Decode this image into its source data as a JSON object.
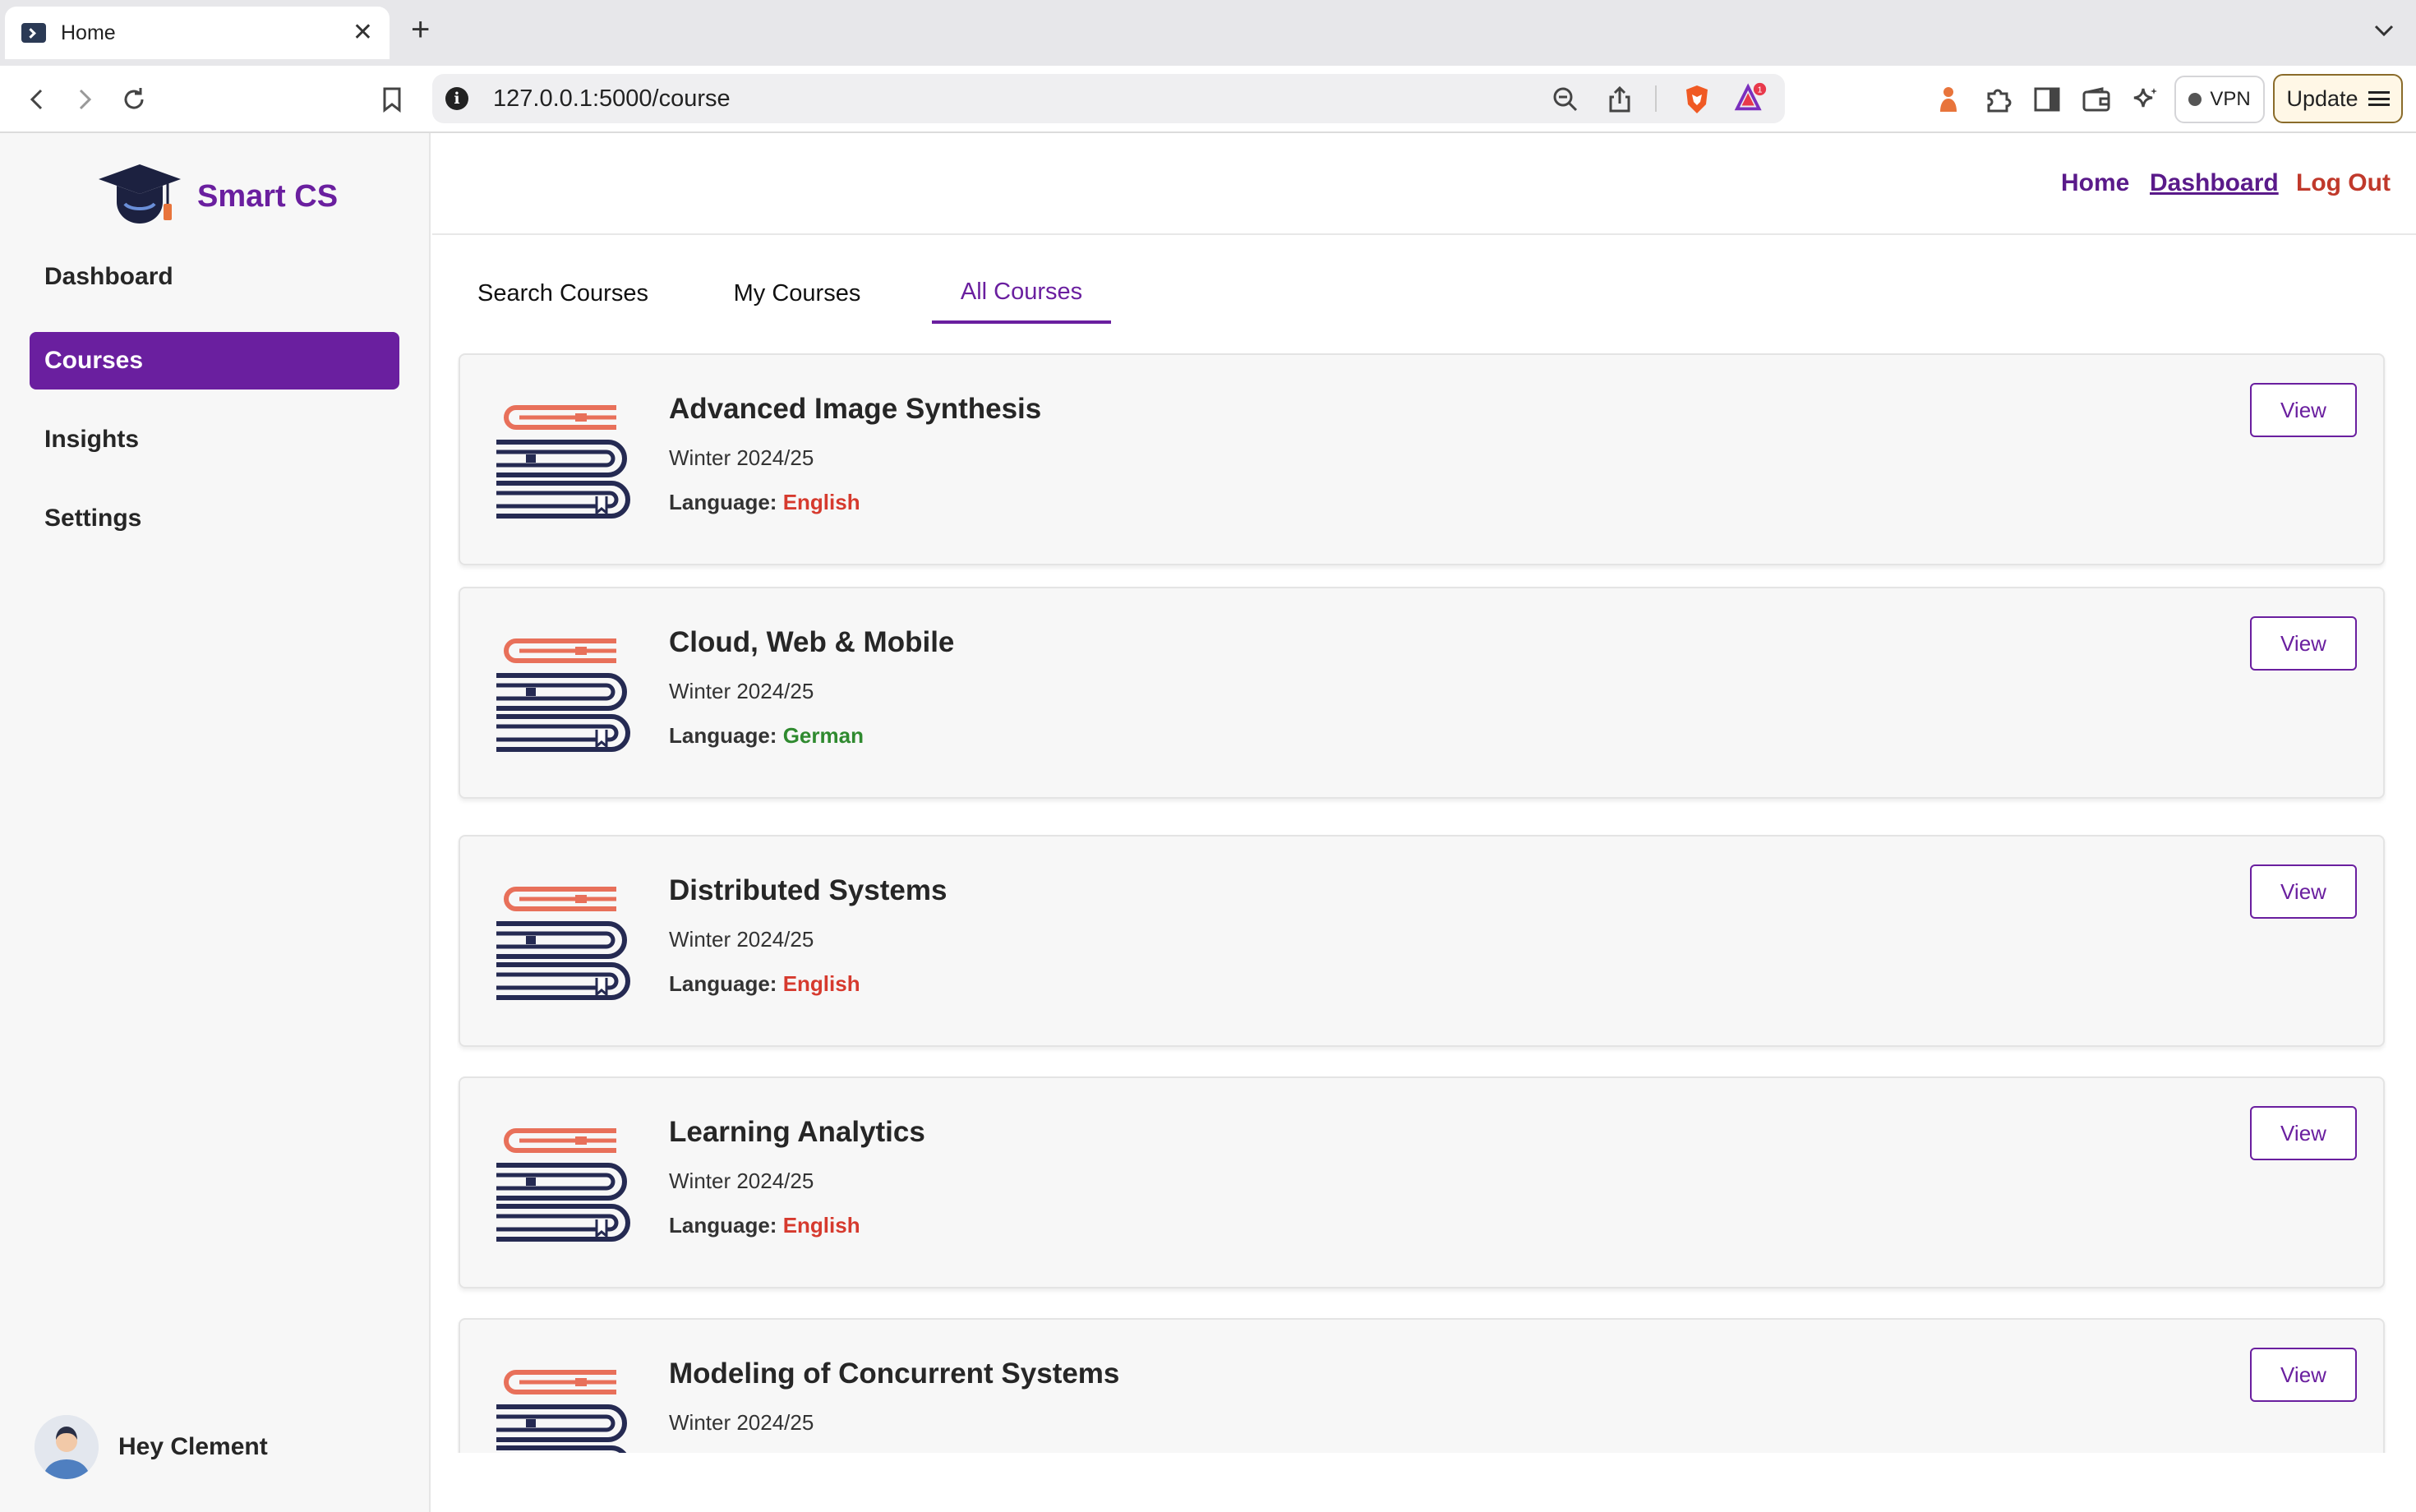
{
  "browser": {
    "tab_title": "Home",
    "url": "127.0.0.1:5000/course",
    "notification_count": "1",
    "vpn_label": "VPN",
    "update_label": "Update"
  },
  "app": {
    "brand": "Smart CS",
    "sidebar": {
      "items": [
        {
          "label": "Dashboard",
          "active": false
        },
        {
          "label": "Courses",
          "active": true
        },
        {
          "label": "Insights",
          "active": false
        },
        {
          "label": "Settings",
          "active": false
        }
      ],
      "user_greeting": "Hey Clement"
    },
    "topnav": {
      "home": "Home",
      "dashboard": "Dashboard",
      "logout": "Log Out"
    },
    "tabs": [
      {
        "label": "Search Courses",
        "active": false
      },
      {
        "label": "My Courses",
        "active": false
      },
      {
        "label": "All Courses",
        "active": true
      }
    ],
    "language_label": "Language:",
    "view_label": "View",
    "courses": [
      {
        "title": "Advanced Image Synthesis",
        "term": "Winter 2024/25",
        "language": "English"
      },
      {
        "title": "Cloud, Web & Mobile",
        "term": "Winter 2024/25",
        "language": "German"
      },
      {
        "title": "Distributed Systems",
        "term": "Winter 2024/25",
        "language": "English"
      },
      {
        "title": "Learning Analytics",
        "term": "Winter 2024/25",
        "language": "English"
      },
      {
        "title": "Modeling of Concurrent Systems",
        "term": "Winter 2024/25",
        "language": ""
      }
    ],
    "colors": {
      "accent": "#6a1f9f",
      "english": "#d63a2e",
      "german": "#2f8a2f",
      "logout": "#c0392b"
    }
  }
}
